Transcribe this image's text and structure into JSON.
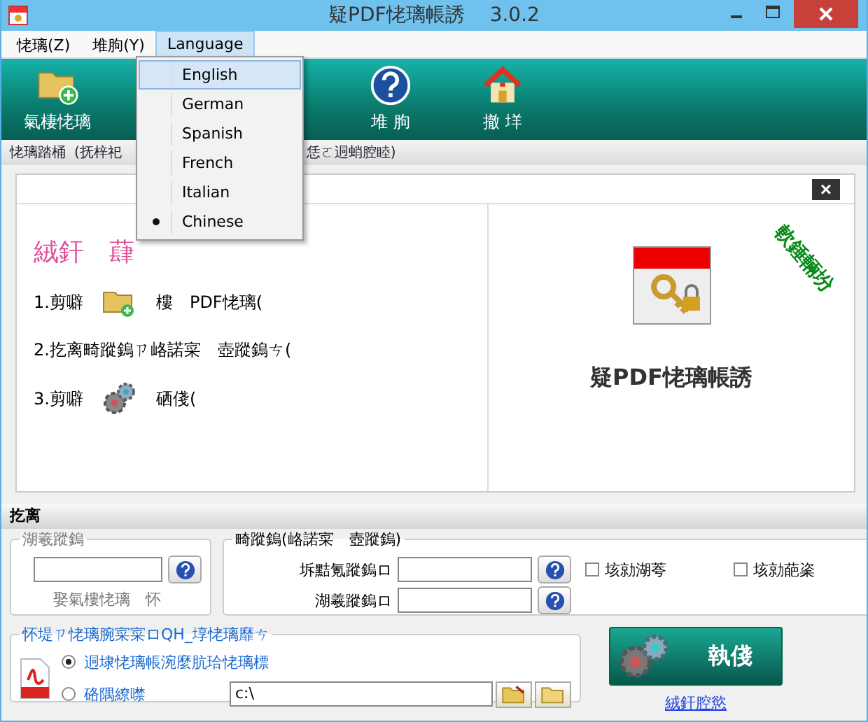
{
  "window": {
    "title": "疑PDF恅璃帳誘",
    "version": "3.0.2"
  },
  "menu_bar": [
    {
      "label": "恅璃(Z)",
      "selected": false
    },
    {
      "label": "堆朐(Y)",
      "selected": false
    },
    {
      "label": "Language",
      "selected": true
    }
  ],
  "language_menu": [
    {
      "label": "English",
      "hovered": true,
      "checked": false
    },
    {
      "label": "German",
      "hovered": false,
      "checked": false
    },
    {
      "label": "Spanish",
      "hovered": false,
      "checked": false
    },
    {
      "label": "French",
      "hovered": false,
      "checked": false
    },
    {
      "label": "Italian",
      "hovered": false,
      "checked": false
    },
    {
      "label": "Chinese",
      "hovered": false,
      "checked": true
    }
  ],
  "toolbar": [
    {
      "label": "氣棲恅璃",
      "kind": "folder"
    },
    {
      "label": "堆 朐",
      "kind": "help"
    },
    {
      "label": "撤 垟",
      "kind": "home"
    }
  ],
  "hint_strip": {
    "label": "恅璃踏桶",
    "text_before": "(抚梓祀",
    "text_after": "恁ㄛ迵蛸腔睦)"
  },
  "welcome": {
    "close": "×",
    "heading": "絨釬　蕼",
    "stamp": "軟錘輛坋",
    "app_name": "疑PDF恅璃帳誘",
    "steps": [
      {
        "kind": "folder",
        "number": "1.剪噼",
        "text": "樓　PDF恅璃("
      },
      {
        "kind": "plain",
        "number": "2.扢离畸蹤鎢ㄗ峈諾寀　壺蹤鎢ㄘ("
      },
      {
        "kind": "gear",
        "number": "3.剪噼",
        "text": "硒俴("
      }
    ]
  },
  "settings_bar": "扢离",
  "open_password": {
    "legend": "湖羲蹤鎢",
    "hint": "娶氣樓恅璃　怀"
  },
  "permissions": {
    "legend": "畸蹤鎢(峈諾寀　壺蹤鎢)",
    "owner_label": "坼黠氪蹤鎢ロ",
    "open_label": "湖羲蹤鎢ロ",
    "checkboxes": [
      {
        "label": "垓勍湖荂",
        "checked": false
      },
      {
        "label": "垓勍葩秶",
        "checked": false
      }
    ]
  },
  "output": {
    "legend": "怀堤ㄗ恅璃腕寀寀ロQH_埻恅璃靡ㄘ",
    "path": "c:\\",
    "options": [
      {
        "label": "迵埭恅璃帳涴麼肮珨恅璃標",
        "selected": true
      },
      {
        "label": "硌隅繚噤",
        "selected": false
      }
    ]
  },
  "run_button": "執俴",
  "help_link": "絨釬腔慾"
}
